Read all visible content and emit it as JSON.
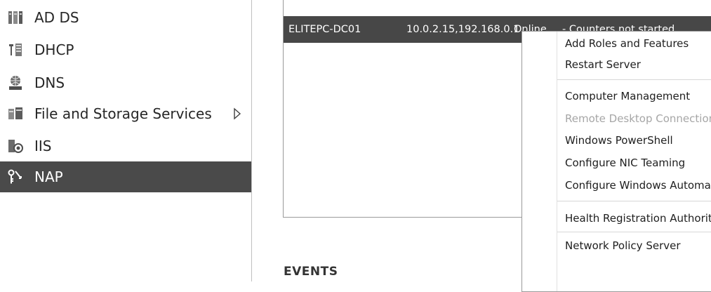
{
  "nav": {
    "items": [
      {
        "label": "AD DS",
        "icon": "ad-ds-icon",
        "selected": false,
        "has_submenu": false
      },
      {
        "label": "DHCP",
        "icon": "dhcp-icon",
        "selected": false,
        "has_submenu": false
      },
      {
        "label": "DNS",
        "icon": "dns-icon",
        "selected": false,
        "has_submenu": false
      },
      {
        "label": "File and Storage Services",
        "icon": "file-storage-icon",
        "selected": false,
        "has_submenu": true
      },
      {
        "label": "IIS",
        "icon": "iis-icon",
        "selected": false,
        "has_submenu": false
      },
      {
        "label": "NAP",
        "icon": "nap-icon",
        "selected": true,
        "has_submenu": false
      }
    ]
  },
  "servers": {
    "selected_row": {
      "name": "ELITEPC-DC01",
      "ip": "10.0.2.15,192.168.0.1",
      "status": "Online",
      "rest": "- Counters not started"
    }
  },
  "events": {
    "title": "EVENTS"
  },
  "context_menu": {
    "items": [
      {
        "label": "Add Roles and Features",
        "disabled": false
      },
      {
        "label": "Restart Server",
        "disabled": false
      },
      {
        "separator": true
      },
      {
        "label": "Computer Management",
        "disabled": false
      },
      {
        "label": "Remote Desktop Connection",
        "disabled": true
      },
      {
        "label": "Windows PowerShell",
        "disabled": false
      },
      {
        "label": "Configure NIC Teaming",
        "disabled": false
      },
      {
        "label": "Configure Windows Automatic Feedback",
        "disabled": false
      },
      {
        "separator": true
      },
      {
        "label": "Health Registration Authority",
        "disabled": false
      },
      {
        "separator": true
      },
      {
        "label": "Network Policy Server",
        "disabled": false
      }
    ]
  },
  "colors": {
    "selected_bg": "#4a4a4a",
    "row_bg": "#474747",
    "disabled_text": "#a6a6a6"
  }
}
